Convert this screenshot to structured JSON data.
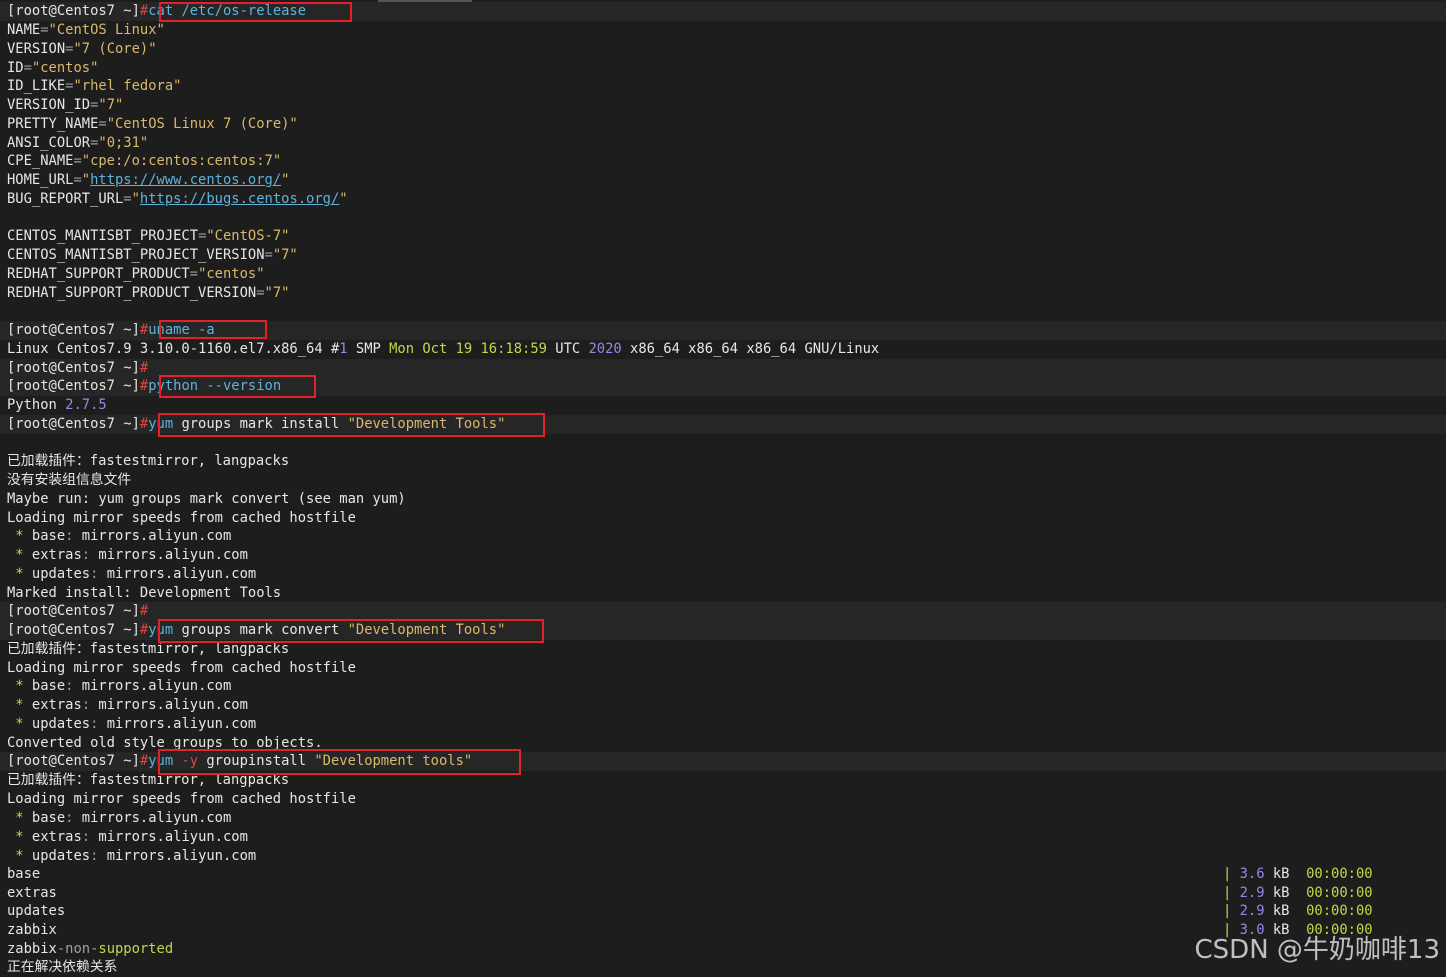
{
  "prompt": "[root@Centos7 ~]",
  "hash": "#",
  "commands": {
    "cat": "cat /etc/os-release",
    "uname": "uname -a",
    "python": "python --version",
    "mark_install_pre": "yum",
    "mark_install_mid": " groups mark install ",
    "mark_install_str": "\"Development Tools\"",
    "mark_convert_pre": "yum",
    "mark_convert_mid": " groups mark convert ",
    "mark_convert_str": "\"Development Tools\"",
    "groupinstall_pre": "yum",
    "groupinstall_flag": " -y",
    "groupinstall_mid": " groupinstall ",
    "groupinstall_str": "\"Development tools\""
  },
  "os_release": [
    {
      "k": "NAME",
      "v": "\"CentOS Linux\""
    },
    {
      "k": "VERSION",
      "v": "\"7 (Core)\""
    },
    {
      "k": "ID",
      "v": "\"centos\""
    },
    {
      "k": "ID_LIKE",
      "v": "\"rhel fedora\""
    },
    {
      "k": "VERSION_ID",
      "v": "\"7\""
    },
    {
      "k": "PRETTY_NAME",
      "v": "\"CentOS Linux 7 (Core)\""
    },
    {
      "k": "ANSI_COLOR",
      "v": "\"0;31\""
    },
    {
      "k": "CPE_NAME",
      "v": "\"cpe:/o:centos:centos:7\""
    },
    {
      "k": "HOME_URL",
      "v": "https://www.centos.org/"
    },
    {
      "k": "BUG_REPORT_URL",
      "v": "https://bugs.centos.org/"
    },
    {
      "k": "CENTOS_MANTISBT_PROJECT",
      "v": "\"CentOS-7\""
    },
    {
      "k": "CENTOS_MANTISBT_PROJECT_VERSION",
      "v": "\"7\""
    },
    {
      "k": "REDHAT_SUPPORT_PRODUCT",
      "v": "\"centos\""
    },
    {
      "k": "REDHAT_SUPPORT_PRODUCT_VERSION",
      "v": "\"7\""
    }
  ],
  "uname_output": {
    "a": "Linux Centos7.9 3.10.0-1160.el7.x86_64 #",
    "b": "1",
    "c": " SMP ",
    "d": "Mon Oct ",
    "e": "19 16:18:59",
    "f": " UTC ",
    "g": "2020",
    "h": " x86_64 x86_64 x86_64 GNU/Linux"
  },
  "python_output": {
    "name": "Python ",
    "ver": "2.7.5"
  },
  "plugins_line": "已加载插件：fastestmirror, langpacks",
  "no_group_file": "没有安装组信息文件",
  "maybe_run": "Maybe run: yum groups mark convert (see man yum)",
  "loading_mirror": "Loading mirror speeds from cached hostfile",
  "mirrors": [
    {
      "repo": "base",
      "host": "mirrors.aliyun.com"
    },
    {
      "repo": "extras",
      "host": "mirrors.aliyun.com"
    },
    {
      "repo": "updates",
      "host": "mirrors.aliyun.com"
    }
  ],
  "marked_install": "Marked install: Development Tools",
  "converted": "Converted old style groups to objects.",
  "repos": [
    {
      "name": "base",
      "size": "3.6",
      "unit": "kB",
      "time": "00:00:00"
    },
    {
      "name": "extras",
      "size": "2.9",
      "unit": "kB",
      "time": "00:00:00"
    },
    {
      "name": "updates",
      "size": "2.9",
      "unit": "kB",
      "time": "00:00:00"
    },
    {
      "name": "zabbix",
      "size": "3.0",
      "unit": "kB",
      "time": "00:00:00"
    }
  ],
  "zabbix_non": {
    "a": "zabbix",
    "b": "-non-",
    "c": "supported"
  },
  "resolving": "正在解决依赖关系",
  "watermark": "CSDN @牛奶咖啡13",
  "colors": {
    "background": "#1d1d1d",
    "prompt_hash": "#e0443e",
    "command": "#5fb3d9",
    "string": "#d9b86c",
    "number": "#9e84e6",
    "time": "#c4d64a",
    "highlight_box": "#e5202a"
  }
}
